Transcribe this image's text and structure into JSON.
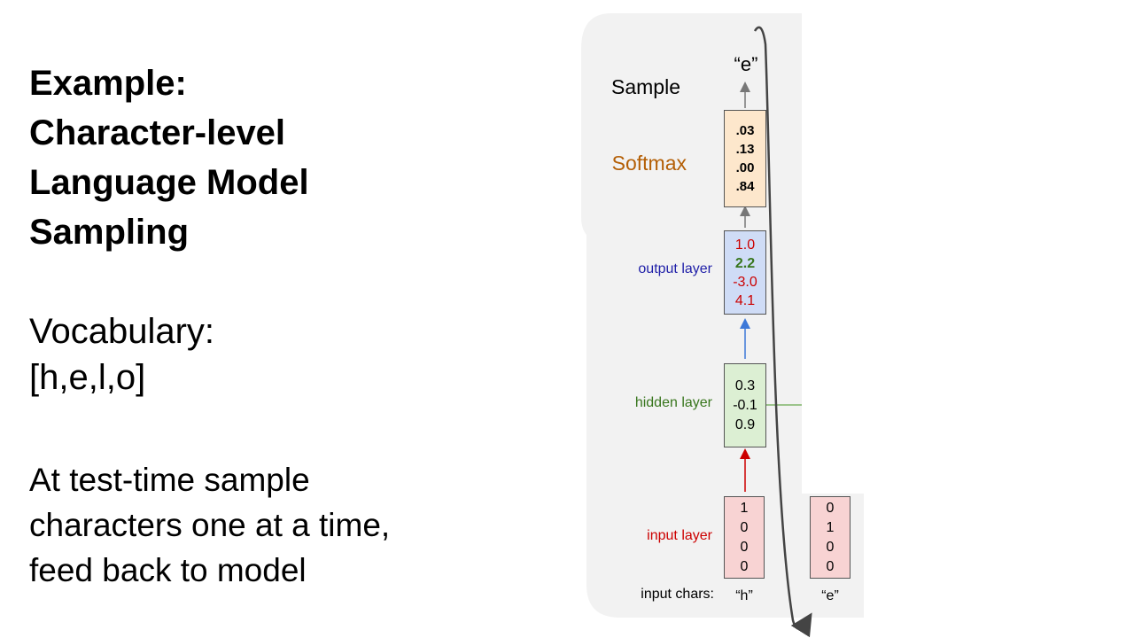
{
  "title": {
    "line1": "Example:",
    "line2": "Character-level",
    "line3": "Language Model",
    "line4": "Sampling"
  },
  "vocab": {
    "heading": "Vocabulary:",
    "list": "[h,e,l,o]"
  },
  "note": {
    "line1": "At test-time sample",
    "line2": "characters one at a time,",
    "line3": "feed back to model"
  },
  "diagram": {
    "sample_label": "Sample",
    "sampled_char": "“e”",
    "softmax_label": "Softmax",
    "softmax_values": [
      ".03",
      ".13",
      ".00",
      ".84"
    ],
    "output_label": "output layer",
    "output_values": [
      "1.0",
      "2.2",
      "-3.0",
      "4.1"
    ],
    "hidden_label": "hidden layer",
    "hidden_values": [
      "0.3",
      "-0.1",
      "0.9"
    ],
    "input_label": "input layer",
    "input_values_h": [
      "1",
      "0",
      "0",
      "0"
    ],
    "input_values_e": [
      "0",
      "1",
      "0",
      "0"
    ],
    "input_chars_label": "input chars:",
    "input_char_1": "“h”",
    "input_char_2": "“e”",
    "colors": {
      "panel": "#f2f2f2",
      "softmax_label": "#b45f06",
      "output_label": "#1f1fa8",
      "hidden_label": "#38761d",
      "input_label": "#cc0000",
      "output_red": "#cc0000",
      "output_green": "#38761d"
    }
  }
}
